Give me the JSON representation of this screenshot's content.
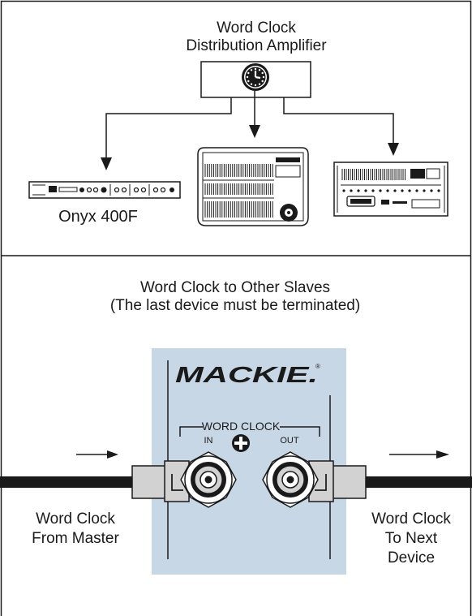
{
  "top": {
    "title_line1": "Word Clock",
    "title_line2": "Distribution Amplifier",
    "device_label": "Onyx 400F"
  },
  "bottom": {
    "title_line1": "Word Clock to Other Slaves",
    "title_line2": "(The last device must be terminated)",
    "brand": "MACKIE.",
    "brand_mark": "®",
    "port_group_label": "WORD CLOCK",
    "in_label": "IN",
    "out_label": "OUT",
    "left_caption_line1": "Word Clock",
    "left_caption_line2": "From Master",
    "right_caption_line1": "Word Clock",
    "right_caption_line2": "To Next",
    "right_caption_line3": "Device"
  },
  "colors": {
    "panel": "#c8d7e6",
    "line": "#1a1a1a",
    "cable": "#1a1a1a",
    "plug": "#d2d2d2"
  },
  "icons": [
    "clock-icon",
    "ground-screw-icon",
    "arrow-right-icon"
  ]
}
